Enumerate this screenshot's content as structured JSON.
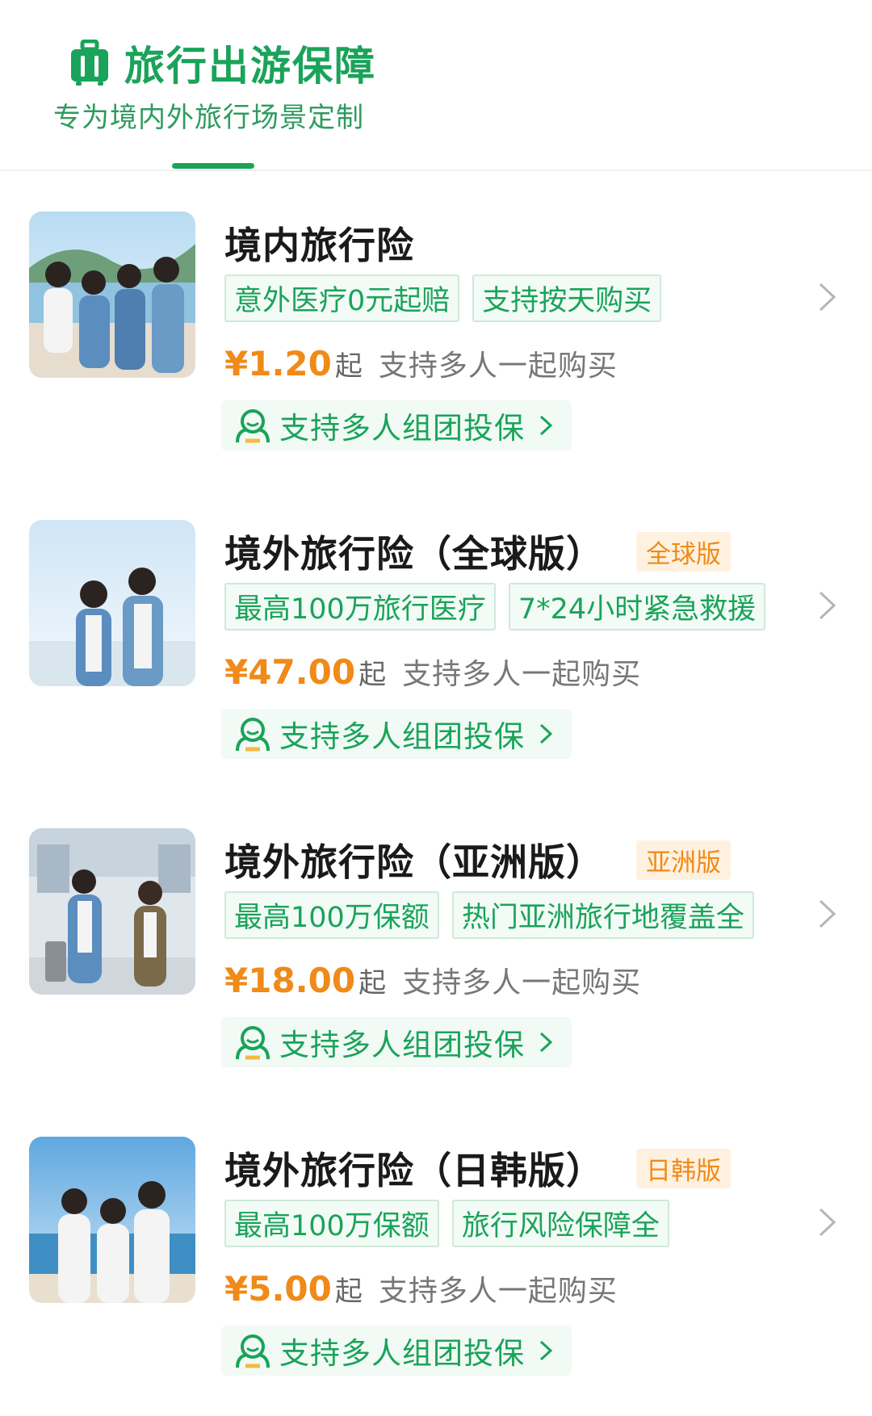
{
  "header": {
    "title": "旅行出游保障",
    "subtitle": "专为境内外旅行场景定制"
  },
  "colors": {
    "brand_green": "#1aa35a",
    "price_orange": "#f08a18",
    "badge_bg": "#fff1e0"
  },
  "products": [
    {
      "title": "境内旅行险",
      "badge": "",
      "tags": [
        "意外医疗0元起赔",
        "支持按天购买"
      ],
      "price": "¥1.20",
      "price_suffix": "起",
      "price_desc": "支持多人一起购买",
      "group_label": "支持多人组团投保"
    },
    {
      "title": "境外旅行险（全球版）",
      "badge": "全球版",
      "tags": [
        "最高100万旅行医疗",
        "7*24小时紧急救援"
      ],
      "price": "¥47.00",
      "price_suffix": "起",
      "price_desc": "支持多人一起购买",
      "group_label": "支持多人组团投保"
    },
    {
      "title": "境外旅行险（亚洲版）",
      "badge": "亚洲版",
      "tags": [
        "最高100万保额",
        "热门亚洲旅行地覆盖全"
      ],
      "price": "¥18.00",
      "price_suffix": "起",
      "price_desc": "支持多人一起购买",
      "group_label": "支持多人组团投保"
    },
    {
      "title": "境外旅行险（日韩版）",
      "badge": "日韩版",
      "tags": [
        "最高100万保额",
        "旅行风险保障全"
      ],
      "price": "¥5.00",
      "price_suffix": "起",
      "price_desc": "支持多人一起购买",
      "group_label": "支持多人组团投保"
    }
  ]
}
